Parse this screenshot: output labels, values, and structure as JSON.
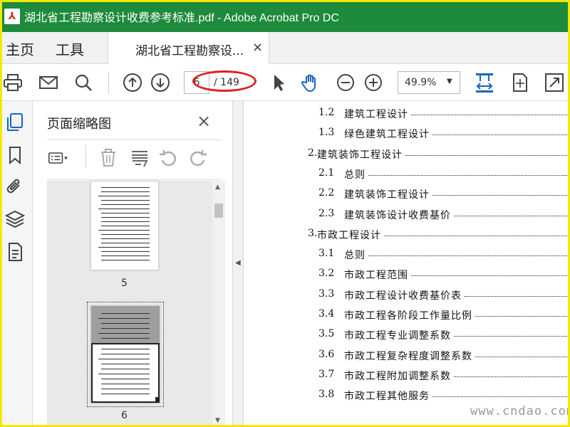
{
  "window": {
    "title": "湖北省工程勘察设计收费参考标准.pdf - Adobe Acrobat Pro DC",
    "app_icon": "acrobat-icon",
    "accent_color": "#1e8a3c"
  },
  "menu": {
    "home": "主页",
    "tools": "工具"
  },
  "tab": {
    "label": "湖北省工程勘察设...",
    "close": "×"
  },
  "toolbar": {
    "page_value": "6",
    "page_total": "/ 149",
    "zoom": "49.9%"
  },
  "panel": {
    "title": "页面缩略图",
    "close": "×",
    "thumbnails": [
      {
        "label": "5"
      },
      {
        "label": "6"
      }
    ]
  },
  "toc": [
    {
      "num": "1.2",
      "text": "建筑工程设计"
    },
    {
      "num": "1.3",
      "text": "绿色建筑工程设计"
    },
    {
      "num": "2.",
      "text": "建筑装饰工程设计"
    },
    {
      "num": "2.1",
      "text": "总则"
    },
    {
      "num": "2.2",
      "text": "建筑装饰工程设计"
    },
    {
      "num": "2.3",
      "text": "建筑装饰设计收费基价"
    },
    {
      "num": "3.",
      "text": "市政工程设计"
    },
    {
      "num": "3.1",
      "text": "总则"
    },
    {
      "num": "3.2",
      "text": "市政工程范围"
    },
    {
      "num": "3.3",
      "text": "市政工程设计收费基价表"
    },
    {
      "num": "3.4",
      "text": "市政工程各阶段工作量比例"
    },
    {
      "num": "3.5",
      "text": "市政工程专业调整系数"
    },
    {
      "num": "3.6",
      "text": "市政工程复杂程度调整系数"
    },
    {
      "num": "3.7",
      "text": "市政工程附加调整系数"
    },
    {
      "num": "3.8",
      "text": "市政工程其他服务"
    }
  ],
  "watermark": "www.cndao.com"
}
